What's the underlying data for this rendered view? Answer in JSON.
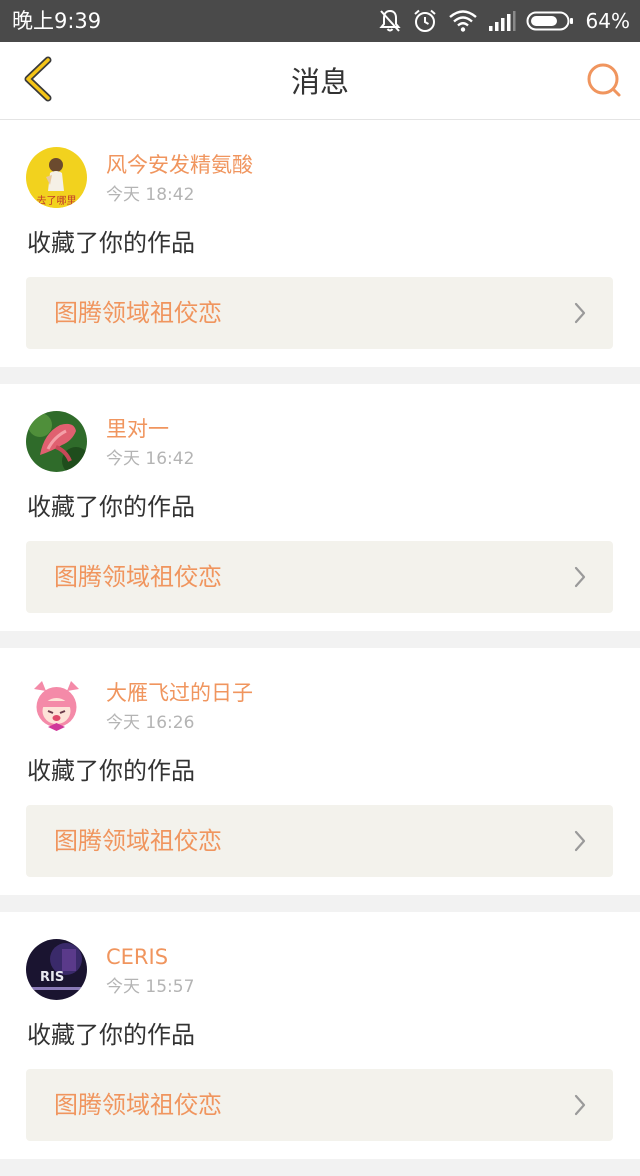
{
  "status_bar": {
    "time": "晚上9:39",
    "battery": "64%",
    "icons": [
      "mute-icon",
      "alarm-icon",
      "wifi-icon",
      "signal-icon",
      "battery-icon"
    ]
  },
  "header": {
    "title": "消息",
    "back_icon": "back-chevron-icon",
    "search_icon": "search-icon"
  },
  "colors": {
    "accent": "#f0955e",
    "back_icon": "#f5c518",
    "card_link_bg": "#f3f2ec",
    "status_bar": "#4a4a4a"
  },
  "messages": [
    {
      "user": "风今安发精氨酸",
      "time": "今天 18:42",
      "action": "收藏了你的作品",
      "work_title": "图腾领域祖佼恋",
      "avatar": "yellow-photo-avatar",
      "avatar_text": "去了哪里"
    },
    {
      "user": "里对一",
      "time": "今天 16:42",
      "action": "收藏了你的作品",
      "work_title": "图腾领域祖佼恋",
      "avatar": "pink-flower-avatar"
    },
    {
      "user": "大雁飞过的日子",
      "time": "今天 16:26",
      "action": "收藏了你的作品",
      "work_title": "图腾领域祖佼恋",
      "avatar": "cartoon-girl-avatar"
    },
    {
      "user": "CERIS",
      "time": "今天 15:57",
      "action": "收藏了你的作品",
      "work_title": "图腾领域祖佼恋",
      "avatar": "dark-logo-avatar",
      "avatar_text": "RIS"
    }
  ]
}
